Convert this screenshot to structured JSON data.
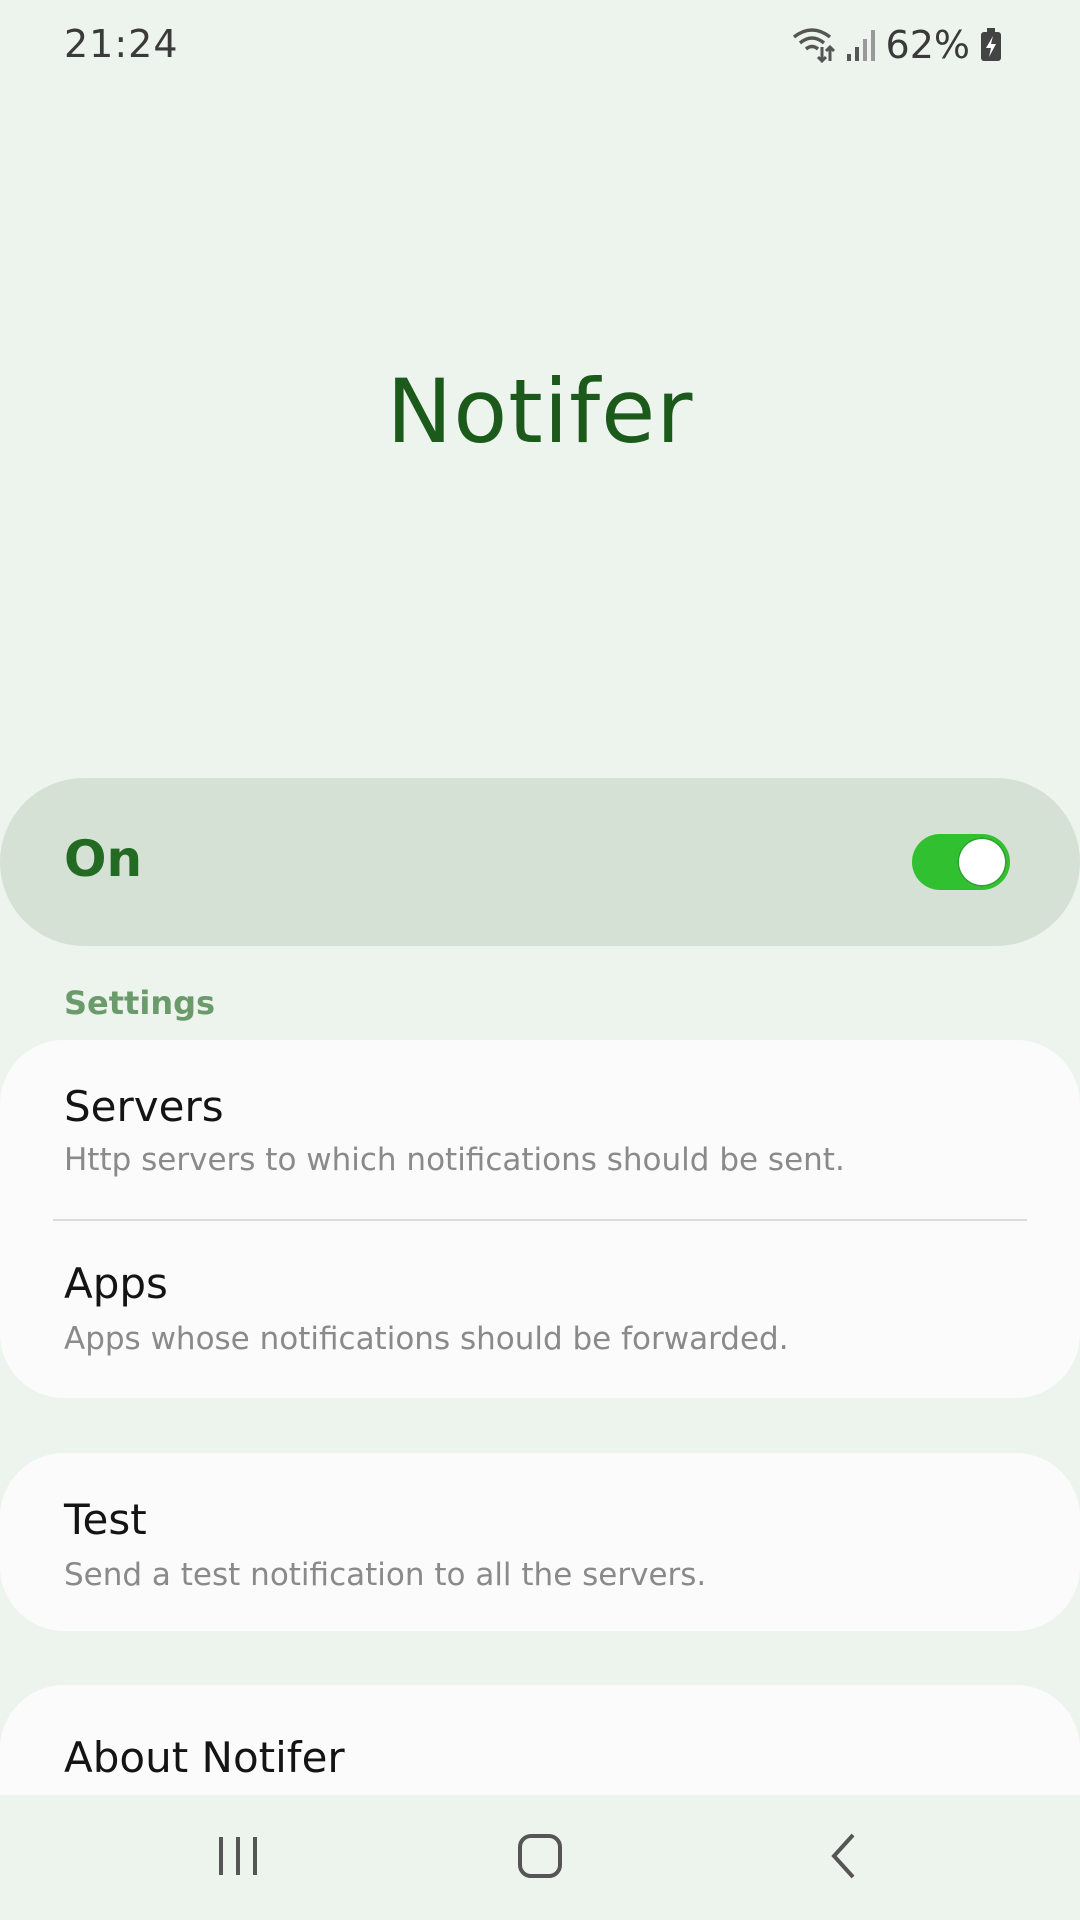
{
  "status_bar": {
    "time": "21:24",
    "battery_percent": "62%",
    "icons": [
      "wifi-icon",
      "signal-icon",
      "battery-charging-icon"
    ]
  },
  "app": {
    "title": "Notifer"
  },
  "master_switch": {
    "label": "On",
    "enabled": true,
    "accent_color": "#30c030"
  },
  "settings": {
    "header": "Settings",
    "items": [
      {
        "title": "Servers",
        "subtitle": "Http servers to which notifications should be sent."
      },
      {
        "title": "Apps",
        "subtitle": "Apps whose notifications should be forwarded."
      }
    ]
  },
  "test": {
    "title": "Test",
    "subtitle": "Send a test notification to all the servers."
  },
  "about": {
    "title": "About Notifer"
  },
  "nav_bar": {
    "buttons": [
      "recent-apps-icon",
      "home-icon",
      "back-icon"
    ]
  },
  "colors": {
    "background": "#edf3ed",
    "title": "#1c5a1c",
    "section_header": "#6b9b6b",
    "card": "#fbfbfb"
  }
}
